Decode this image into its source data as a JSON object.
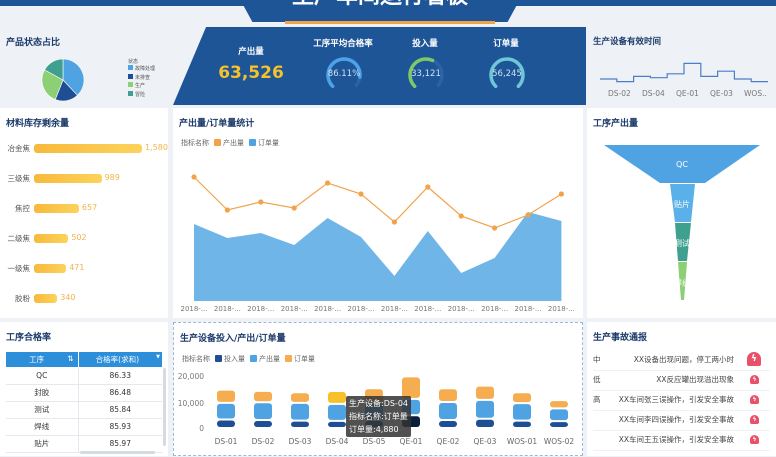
{
  "header": {
    "title": "生产车间运行看板"
  },
  "kpis": {
    "output": {
      "label": "产出量",
      "value": "63,526"
    },
    "pass_rate": {
      "label": "工序平均合格率",
      "value": "86.11%",
      "fraction": 0.8611,
      "color": "#4da3e8"
    },
    "input": {
      "label": "投入量",
      "value": "33,121",
      "fraction": 0.59,
      "color": "#7dc96a"
    },
    "orders": {
      "label": "订单量",
      "value": "56,245",
      "fraction": 1.0,
      "color": "#6fc7d6"
    }
  },
  "pie": {
    "title": "产品状态占比",
    "legend_title": "状态",
    "slices": [
      {
        "label": "故障处理",
        "value": 38,
        "color": "#4fa3e3"
      },
      {
        "label": "未排查",
        "value": 18,
        "color": "#1e4f94"
      },
      {
        "label": "生产",
        "value": 27,
        "color": "#8ccf74"
      },
      {
        "label": "冒险",
        "value": 17,
        "color": "#3fa08f"
      }
    ]
  },
  "uptime": {
    "title": "生产设备有效时间",
    "x_labels": [
      "DS-02",
      "DS-04",
      "QE-01",
      "QE-03",
      "WOS.."
    ],
    "values": [
      5,
      4,
      6,
      5.5,
      7,
      11,
      6,
      8,
      5,
      4
    ]
  },
  "inventory": {
    "title": "材料库存剩余量",
    "items": [
      {
        "label": "冶金焦",
        "value": 1580,
        "text": "1,580"
      },
      {
        "label": "三级焦",
        "value": 989,
        "text": "989"
      },
      {
        "label": "焦控",
        "value": 657,
        "text": "657"
      },
      {
        "label": "二级焦",
        "value": 502,
        "text": "502"
      },
      {
        "label": "一级焦",
        "value": 471,
        "text": "471"
      },
      {
        "label": "胶粉",
        "value": 340,
        "text": "340"
      }
    ]
  },
  "funnel": {
    "title": "工序产出量",
    "stages": [
      "QC",
      "贴片",
      "测试",
      "焊线"
    ]
  },
  "quality": {
    "title": "工序合格率",
    "headers": [
      "工序",
      "合格率(求和)"
    ],
    "rows": [
      [
        "QC",
        "86.33"
      ],
      [
        "封胶",
        "86.48"
      ],
      [
        "测试",
        "85.84"
      ],
      [
        "焊线",
        "85.93"
      ],
      [
        "贴片",
        "85.97"
      ]
    ]
  },
  "accidents": {
    "title": "生产事故通报",
    "rows": [
      {
        "level": "中",
        "text": "XX设备出现问题，停工两小时"
      },
      {
        "level": "低",
        "text": "XX反应罐出现溢出现象"
      },
      {
        "level": "高",
        "text": "XX车间张三误操作，引发安全事故"
      },
      {
        "level": "",
        "text": "XX车间李四误操作，引发安全事故"
      },
      {
        "level": "",
        "text": "XX车间王五误操作，引发安全事故"
      }
    ]
  },
  "chart_data": [
    {
      "type": "line",
      "title": "产出量/订单量统计",
      "legend_title": "指标名称",
      "categories": [
        "2018-...",
        "2018-...",
        "2018-...",
        "2018-...",
        "2018-...",
        "2018-...",
        "2018-...",
        "2018-...",
        "2018-...",
        "2018-...",
        "2018-...",
        "2018-..."
      ],
      "series": [
        {
          "name": "产出量",
          "kind": "line",
          "color": "#f2a34a",
          "values": [
            1240,
            910,
            990,
            930,
            1180,
            1070,
            790,
            1140,
            850,
            730,
            860,
            1070
          ]
        },
        {
          "name": "订单量",
          "kind": "area",
          "color": "#6fb5e8",
          "values": [
            770,
            630,
            680,
            560,
            830,
            640,
            250,
            700,
            280,
            430,
            890,
            800
          ]
        }
      ],
      "ylim": [
        0,
        1400
      ]
    },
    {
      "type": "bar",
      "stacked": true,
      "title": "生产设备投入/产出/订单量",
      "legend_title": "指标名称",
      "categories": [
        "DS-01",
        "DS-02",
        "DS-03",
        "DS-04",
        "DS-05",
        "QE-01",
        "QE-02",
        "QE-03",
        "WOS-01",
        "WOS-02"
      ],
      "yticks": [
        "0",
        "10,000",
        "20,000"
      ],
      "ylim": [
        0,
        20000
      ],
      "series": [
        {
          "name": "投入量",
          "color": "#1e4f94",
          "values": [
            3200,
            3000,
            2800,
            2700,
            3000,
            4800,
            3000,
            3500,
            2800,
            2600
          ]
        },
        {
          "name": "产出量",
          "color": "#4fa3e3",
          "values": [
            6300,
            6700,
            6700,
            6400,
            6500,
            6200,
            6800,
            7100,
            6600,
            4800
          ]
        },
        {
          "name": "订单量",
          "color": "#f5ad4f",
          "values": [
            5000,
            4300,
            4000,
            4880,
            5500,
            8500,
            5200,
            5400,
            4100,
            3100
          ]
        }
      ],
      "tooltip": {
        "line1": "生产设备:DS-04",
        "line2": "指标名称:订单量",
        "line3": "订单量:4,880"
      }
    }
  ]
}
